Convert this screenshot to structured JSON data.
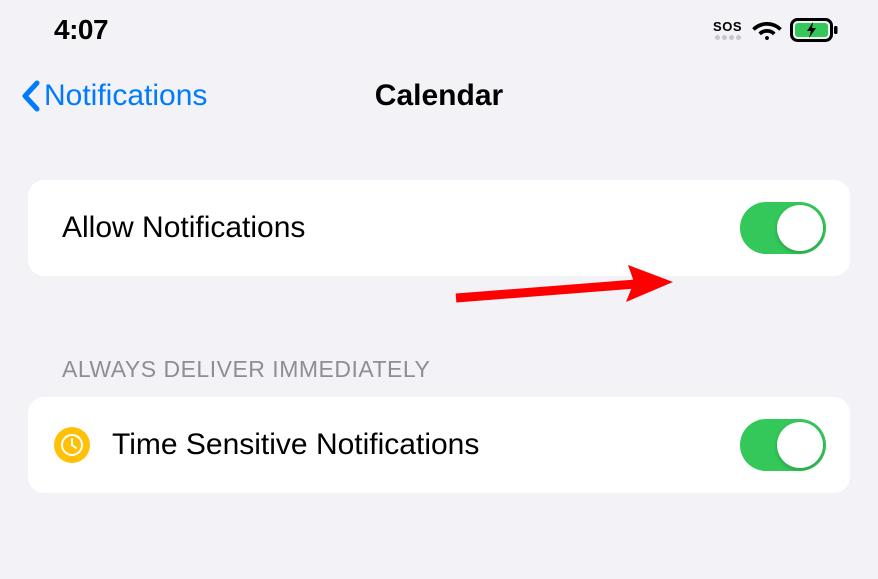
{
  "statusBar": {
    "time": "4:07",
    "sos": "SOS"
  },
  "nav": {
    "back_label": "Notifications",
    "title": "Calendar"
  },
  "rows": {
    "allow_notifications": {
      "label": "Allow Notifications",
      "enabled": true
    },
    "section_header": "ALWAYS DELIVER IMMEDIATELY",
    "time_sensitive": {
      "label": "Time Sensitive Notifications",
      "enabled": true
    }
  },
  "colors": {
    "accent": "#007aff",
    "toggle_on": "#34c759",
    "clock_badge": "#ffc107",
    "arrow": "#ff0000",
    "bg": "#f2f2f7"
  }
}
